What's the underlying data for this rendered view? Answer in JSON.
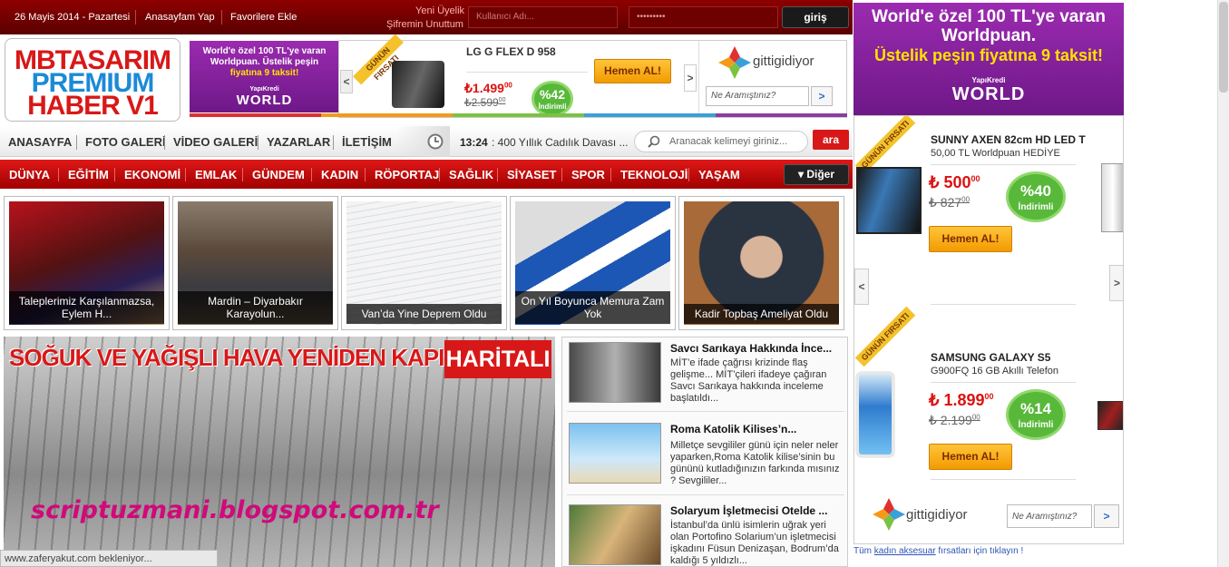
{
  "topbar": {
    "date": "26 Mayis 2014 - Pazartesi",
    "home_link": "Anasayfam Yap",
    "fav_link": "Favorilere Ekle",
    "new_member": "Yeni Üyelik",
    "forgot": "Şifremin Unuttum",
    "username_placeholder": "Kullanıcı Adı...",
    "password_value": "•••••••••",
    "login": "giriş"
  },
  "logo": {
    "line1": "MBTASARIM",
    "line2": "PREMIUM",
    "line3": "HABER V1"
  },
  "world_ad_small": {
    "line1": "World'e özel 100 TL'ye varan",
    "line2": "Worldpuan. Üstelik peşin",
    "line3": "fiyatına 9 taksit!",
    "brand": "WORLD",
    "bank": "YapıKredi"
  },
  "top_deal": {
    "ribbon": "GÜNÜN FIRSATI",
    "product": "LG G FLEX D 958",
    "price": "₺1.499",
    "price_dec": "00",
    "old_price": "₺2.599",
    "old_dec": "00",
    "discount": "%42",
    "discount_label": "İndirimli",
    "button": "Hemen AL!",
    "brand": "gittigidiyor",
    "search_placeholder": "Ne Aramıştınız?",
    "search_btn": ">",
    "prev": "<",
    "next": ">"
  },
  "nav1": {
    "items": [
      "ANASAYFA",
      "FOTO GALERİ",
      "VİDEO GALERİ",
      "YAZARLAR",
      "İLETİŞİM"
    ],
    "ticker_time": "13:24",
    "ticker_text": ": 400 Yıllık Cadılık Davası ...",
    "search_placeholder": "Aranacak kelimeyi giriniz...",
    "search_btn": "ara"
  },
  "nav2": {
    "items": [
      "DÜNYA",
      "EĞİTİM",
      "EKONOMİ",
      "EMLAK",
      "GÜNDEM",
      "KADIN",
      "RÖPORTAJ",
      "SAĞLIK",
      "SİYASET",
      "SPOR",
      "TEKNOLOJİ",
      "YAŞAM"
    ],
    "more": "▾ Diğer"
  },
  "thumbs": [
    {
      "caption": "Taleplerimiz Karşılanmazsa, Eylem H..."
    },
    {
      "caption": "Mardin – Diyarbakır Karayolun..."
    },
    {
      "caption": "Van’da Yine Deprem Oldu"
    },
    {
      "caption": "On Yıl Boyunca Memura Zam Yok"
    },
    {
      "caption": "Kadir Topbaş Ameliyat Oldu"
    }
  ],
  "headline": {
    "title": "SOĞUK VE YAĞIŞLI HAVA YENİDEN KAPIDA",
    "tag": "HARİTALI",
    "watermark": "scriptuzmani.blogspot.com.tr"
  },
  "news": [
    {
      "title": "Savcı Sarıkaya Hakkında İnce...",
      "desc": "MİT’e ifade çağrısı krizinde flaş gelişme... MİT’çileri ifadeye çağıran Savcı Sarıkaya hakkında inceleme başlatıldı..."
    },
    {
      "title": "Roma Katolik Kilises’n...",
      "desc": "Milletçe sevgililer günü için neler neler yaparken,Roma Katolik kilise’sinin bu gününü kutladığınızın farkında mısınız ? Sevgililer..."
    },
    {
      "title": "Solaryum İşletmecisi Otelde ...",
      "desc": "İstanbul’da ünlü isimlerin uğrak yeri olan Portofino Solarium’un işletmecisi işkadını Füsun Denizaşan, Bodrum’da kaldığı 5 yıldızlı..."
    }
  ],
  "status": {
    "text": "www.zaferyakut.com bekleniyor..."
  },
  "right_ad": {
    "line1": "World'e özel  100 TL'ye varan",
    "line2": "Worldpuan.",
    "line3": "Üstelik peşin fiyatına 9 taksit!",
    "brand": "WORLD",
    "bank": "YapıKredi"
  },
  "deals": [
    {
      "ribbon": "GÜNÜN FIRSATI",
      "product": "SUNNY AXEN 82cm HD LED T",
      "sub": "50,00 TL Worldpuan HEDİYE",
      "price": "₺ 500",
      "price_dec": "00",
      "old_price": "₺ 827",
      "old_dec": "00",
      "discount": "%40",
      "discount_label": "İndirimli",
      "button": "Hemen AL!"
    },
    {
      "ribbon": "GÜNÜN FIRSATI",
      "product": "SAMSUNG GALAXY S5",
      "sub": "G900FQ 16 GB Akıllı Telefon",
      "price": "₺ 1.899",
      "price_dec": "00",
      "old_price": "₺ 2.199",
      "old_dec": "00",
      "discount": "%14",
      "discount_label": "İndirimli",
      "button": "Hemen AL!"
    }
  ],
  "right_brand": {
    "name": "gittigidiyor",
    "search_placeholder": "Ne Aramıştınız?",
    "search_btn": ">",
    "prev": "<",
    "next": ">"
  },
  "bottom_link": {
    "pre": "Tüm ",
    "link": "kadın aksesuar",
    "post": " fırsatları için tıklayın !"
  },
  "colors": {
    "brand_red": "#c00000",
    "dark_red": "#5a0000",
    "purple": "#7b1c93",
    "deal_green": "#58b83a",
    "button_orange": "#f29b00"
  }
}
